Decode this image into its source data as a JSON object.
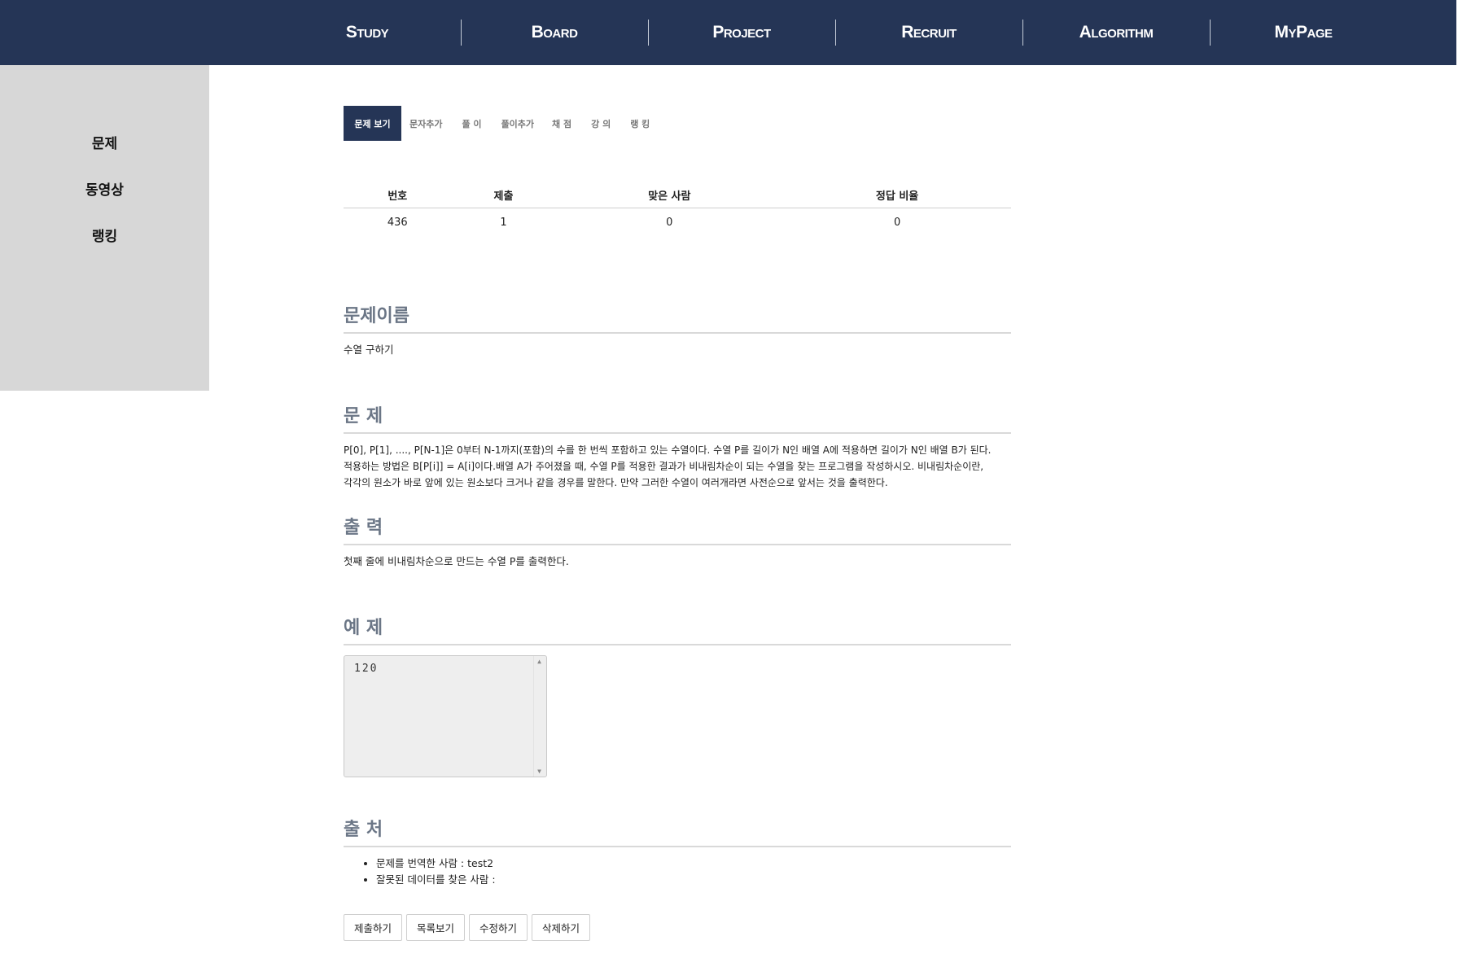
{
  "nav": {
    "items": [
      "Study",
      "Board",
      "Project",
      "Recruit",
      "Algorithm",
      "MyPage"
    ]
  },
  "sidebar": {
    "items": [
      "문제",
      "동영상",
      "랭킹"
    ]
  },
  "tabs": {
    "items": [
      "문제 보기",
      "문자추가",
      "풀 이",
      "풀이추가",
      "채 점",
      "강 의",
      "랭 킹"
    ],
    "active_index": 0
  },
  "stats": {
    "headers": [
      "번호",
      "제출",
      "맞은 사람",
      "정답 비율"
    ],
    "values": [
      "436",
      "1",
      "0",
      "0"
    ]
  },
  "problem": {
    "name_title": "문제이름",
    "name": "수열 구하기",
    "desc_title": "문 제",
    "desc_lines": [
      "P[0], P[1], ...., P[N-1]은 0부터 N-1까지(포함)의 수를 한 번씩 포함하고 있는 수열이다. 수열 P를 길이가 N인 배열 A에 적용하면 길이가 N인 배열 B가 된다.",
      "적용하는 방법은 B[P[i]] = A[i]이다.배열 A가 주어졌을 때, 수열 P를 적용한 결과가 비내림차순이 되는 수열을 찾는 프로그램을 작성하시오. 비내림차순이란,",
      "각각의 원소가 바로 앞에 있는 원소보다 크거나 같을 경우를 말한다. 만약 그러한 수열이 여러개라면 사전순으로 앞서는 것을 출력한다."
    ],
    "output_title": "출 력",
    "output": "첫째 줄에 비내림차순으로 만드는 수열 P를 출력한다.",
    "sample_title": "예 제",
    "sample": "120",
    "source_title": "출 처",
    "source_items": [
      "문제를 번역한 사람 : test2",
      "잘못된 데이터를 찾은 사람 :"
    ]
  },
  "buttons": {
    "submit": "제출하기",
    "list": "목록보기",
    "edit": "수정하기",
    "delete": "삭제하기"
  },
  "colors": {
    "nav_bg": "#253556",
    "sidebar_bg": "#d7d7d7",
    "section_title": "#6b7686"
  }
}
